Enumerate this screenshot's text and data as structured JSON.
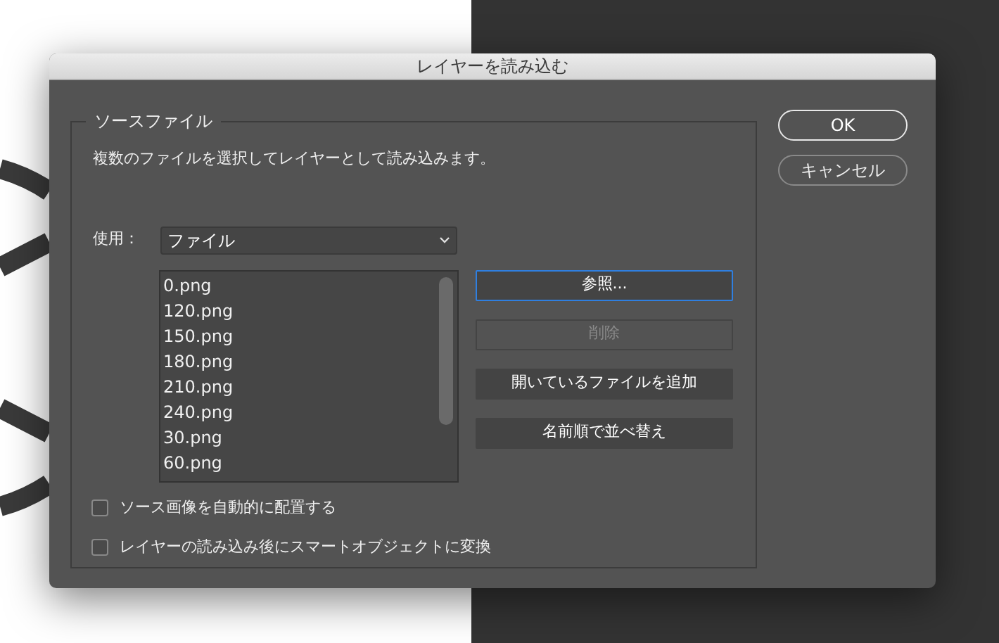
{
  "window": {
    "title": "レイヤーを読み込む"
  },
  "source_group": {
    "legend": "ソースファイル",
    "description": "複数のファイルを選択してレイヤーとして読み込みます。",
    "use": {
      "label": "使用：",
      "value": "ファイル"
    },
    "files": [
      "0.png",
      "120.png",
      "150.png",
      "180.png",
      "210.png",
      "240.png",
      "30.png",
      "60.png"
    ],
    "actions": [
      {
        "label": "参照...",
        "disabled": false,
        "focused": true
      },
      {
        "label": "削除",
        "disabled": true,
        "focused": false
      },
      {
        "label": "開いているファイルを追加",
        "disabled": false,
        "focused": false
      },
      {
        "label": "名前順で並べ替え",
        "disabled": false,
        "focused": false
      }
    ],
    "options": [
      {
        "label": "ソース画像を自動的に配置する",
        "checked": false
      },
      {
        "label": "レイヤーの読み込み後にスマートオブジェクトに変換",
        "checked": false
      }
    ]
  },
  "buttons": [
    {
      "label": "OK",
      "default": true
    },
    {
      "label": "キャンセル",
      "default": false
    }
  ]
}
